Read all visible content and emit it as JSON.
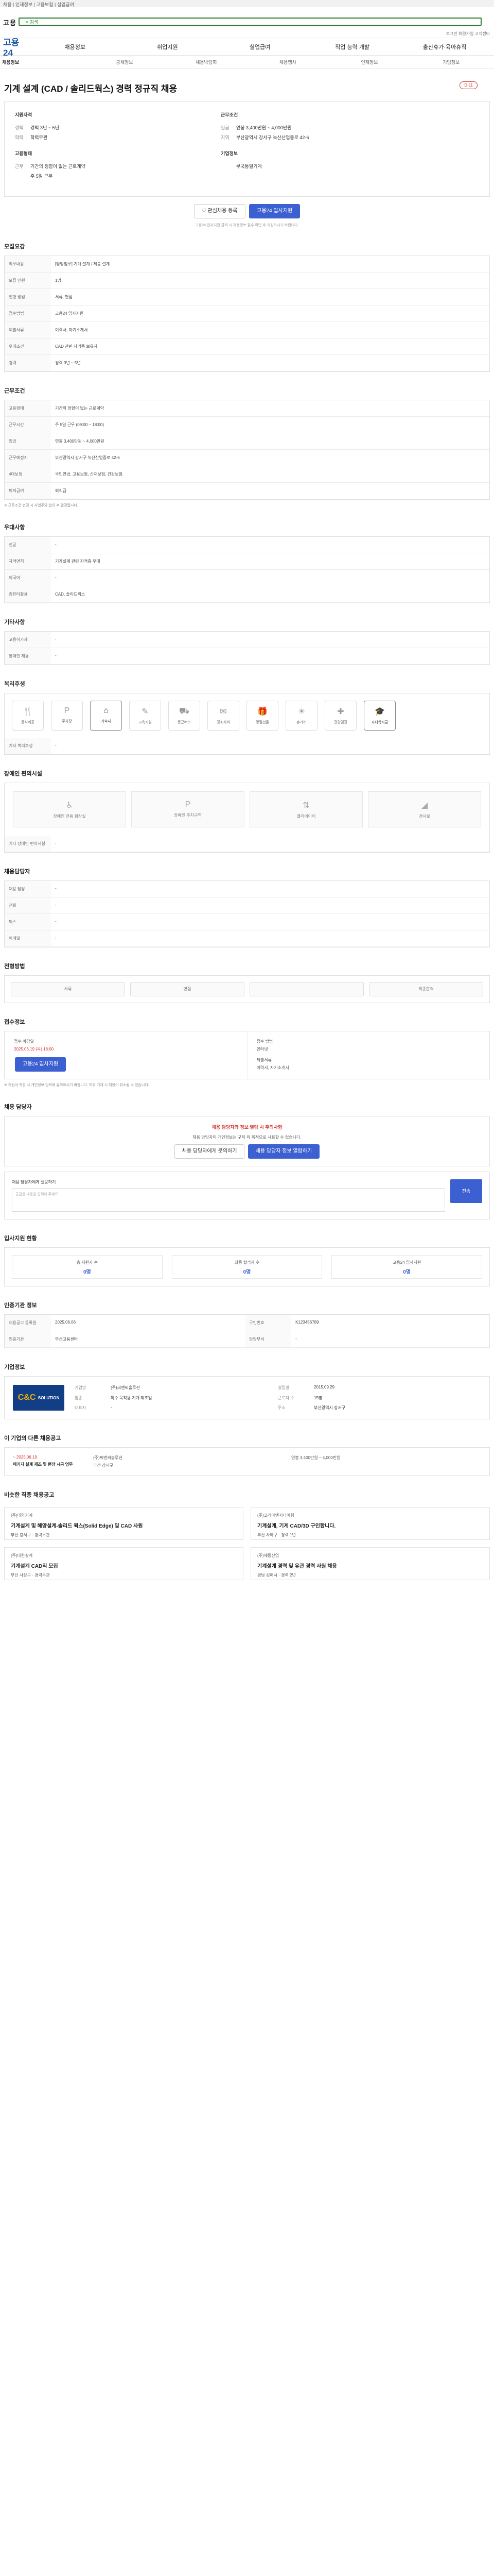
{
  "top_link": "채용 | 인재정보 | 고용보험 | 실업급여",
  "header": {
    "logo": "고용",
    "search_placeholder": "검색",
    "util": "로그인 회원가입 고객센터"
  },
  "gnb": {
    "brand": "고용24",
    "menu": [
      "채용정보",
      "취업지원",
      "실업급여",
      "직업 능력 개발",
      "출산휴가·육아휴직"
    ]
  },
  "subnav": [
    "채용정보",
    "공채정보",
    "채용박람회",
    "채용행사",
    "인재정보",
    "기업정보"
  ],
  "job": {
    "title": "기계 설계 (CAD / 솔리드웍스) 경력 정규직 채용",
    "badge": "D-11",
    "col1_head": "지원자격",
    "col1": [
      [
        "경력",
        "경력 3년 ~ 5년"
      ],
      [
        "학력",
        "학력무관"
      ]
    ],
    "col1b_head": "고용형태",
    "col1b": [
      [
        "근무",
        "기간의 정함이 없는 근로계약"
      ],
      [
        "",
        "주 5일 근무"
      ]
    ],
    "col2_head": "근무조건",
    "col2": [
      [
        "임금",
        "연봉 3,400만원 ~ 4,000만원"
      ],
      [
        "지역",
        "부산광역시 강서구 녹산산업중로 42-6"
      ]
    ],
    "col2b_head": "기업정보",
    "col2b": [
      [
        "",
        "부국통일기계"
      ]
    ],
    "btn_fav": "♡ 관심채용 등록",
    "btn_apply": "고용24 입사지원",
    "note": "고용24 입사지원 클릭 시 채용정보 필수 확인 후 지원하시기 바랍니다."
  },
  "section_jobinfo": "모집요강",
  "job_rows": [
    {
      "k": "직무내용",
      "v": "[담당업무] 기계 설계 / 제품 설계"
    },
    {
      "k": "모집 인원",
      "v": "1명"
    },
    {
      "k": "전형 방법",
      "v": "서류, 면접"
    },
    {
      "k": "접수방법",
      "v": "고용24 입사지원"
    },
    {
      "k": "제출서류",
      "v": "이력서, 자기소개서"
    },
    {
      "k": "우대조건",
      "v": "CAD 관련 자격증 보유자"
    },
    {
      "k": "경력",
      "v": "경력 3년 ~ 5년"
    }
  ],
  "section_work": "근무조건",
  "work_rows": [
    {
      "k": "고용형태",
      "v": "기간의 정함이 없는 근로계약"
    },
    {
      "k": "근무시간",
      "v": "주 5일 근무 (09:00 ~ 18:00)"
    },
    {
      "k": "임금",
      "v": "연봉 3,400만원 ~ 4,000만원"
    },
    {
      "k": "근무예정지",
      "v": "부산광역시 강서구 녹산산업중로 42-6"
    },
    {
      "k": "4대보험",
      "v": "국민연금, 고용보험, 산재보험, 건강보험"
    },
    {
      "k": "퇴직급여",
      "v": "퇴직금"
    }
  ],
  "work_note": "※ 근로조건 변경 시 사업주와 협의 후 결정됩니다.",
  "section_pref": "우대사항",
  "pref_rows": [
    {
      "k": "전공",
      "v": "-"
    },
    {
      "k": "자격면허",
      "v": "기계설계 관련 자격증 우대"
    },
    {
      "k": "외국어",
      "v": "-"
    },
    {
      "k": "컴퓨터활용",
      "v": "CAD, 솔리드웍스"
    }
  ],
  "section_etc": "기타사항",
  "etc_rows": [
    {
      "k": "고용허가제",
      "v": "-"
    },
    {
      "k": "장애인 채용",
      "v": "-"
    }
  ],
  "section_welfare": "복리후생",
  "welfare": [
    "중식제공",
    "주차장",
    "기숙사",
    "교육지원",
    "통근버스",
    "경조사비",
    "명절선물",
    "휴가비",
    "건강검진",
    "자녀학자금"
  ],
  "welfare_on": [
    2,
    9
  ],
  "welfare_extra": {
    "k": "기타 복리후생",
    "v": "-"
  },
  "section_disab": "장애인 편의시설",
  "disab": [
    "장애인 전용 화장실",
    "장애인 주차구역",
    "엘리베이터",
    "경사로"
  ],
  "disab_extra": {
    "k": "기타 장애인 편의시설",
    "v": "-"
  },
  "section_assign": "채용담당자",
  "assign_rows": [
    {
      "k": "채용 담당",
      "v": "-"
    },
    {
      "k": "전화",
      "v": "-"
    },
    {
      "k": "팩스",
      "v": "-"
    },
    {
      "k": "이메일",
      "v": "-"
    }
  ],
  "section_proc": "전형방법",
  "proc_steps": [
    "서류",
    "면접",
    "",
    "최종합격"
  ],
  "section_recv": "접수정보",
  "recv": {
    "k1": "접수 마감일",
    "v1": "2025.06.19 (목) 18:00",
    "k2": "접수 방법",
    "v2": "인터넷",
    "btn": "고용24 입사지원",
    "k3": "제출서류",
    "v3": "이력서, 자기소개서",
    "k4": "제출 서류",
    "v4": "-"
  },
  "recv_notes": "※ 지원서 작성 시 개인정보 입력에 유의하시기 바랍니다. 허위 기재 시 채용이 취소될 수 있습니다.",
  "section_help": "채용 담당자",
  "help": {
    "title": "채용 담당자와 정보 열람 시 주의사항",
    "text": "채용 담당자의 개인정보는 구직 외 목적으로 사용할 수 없습니다.",
    "btn1": "채용 담당자에게 문의하기",
    "btn2": "채용 담당자 정보 열람하기"
  },
  "ask": {
    "label": "채용 담당자에게 질문하기",
    "placeholder": "궁금한 내용을 입력해 주세요.",
    "btn": "전송"
  },
  "section_stats": "입사지원 현황",
  "stats": [
    {
      "k": "총 지원자 수",
      "v": "0명"
    },
    {
      "k": "최종 합격자 수",
      "v": "0명"
    },
    {
      "k": "고용24 입사지원",
      "v": "0명"
    }
  ],
  "section_register": "인증기관 정보",
  "reg_rows": [
    {
      "k": "채용공고 등록일",
      "v": "2025.06.06",
      "k2": "구인번호",
      "v2": "K123456789"
    },
    {
      "k": "인증기관",
      "v": "부산고용센터",
      "k2": "담당부서",
      "v2": "-"
    }
  ],
  "section_company": "기업정보",
  "company": {
    "logo_a": "C&C",
    "logo_b": "SOLUTION",
    "rows": [
      [
        "기업명",
        "(주)씨앤씨솔루션"
      ],
      [
        "설립일",
        "2015.09.29"
      ],
      [
        "업종",
        "특수 목적용 기계 제조업"
      ],
      [
        "근로자 수",
        "15명"
      ],
      [
        "대표자",
        "-"
      ],
      [
        "주소",
        "부산광역시 강서구"
      ]
    ]
  },
  "section_rec": "이 기업의 다른 채용공고",
  "rec": {
    "date": "~ 2025.06.19",
    "title": "패키지 설계 제조 및 현장 시공 업무",
    "co": "(주)씨앤씨솔루션",
    "loc": "부산 강서구",
    "pay": "연봉 3,400만원 ~ 4,000만원"
  },
  "section_similar": "비슷한 직종 채용공고",
  "cards": [
    {
      "co": "(주)대양기계",
      "title": "기계설계 및 해양설계-솔리드 웍스(Solid Edge) 및 CAD 사원",
      "meta": "부산 강서구 · 경력무관"
    },
    {
      "co": "(주)코리아엔지니어링",
      "title": "기계설계, 기계 CAD/3D 구인합니다.",
      "meta": "부산 사하구 · 경력 1년"
    },
    {
      "co": "(주)대한설계",
      "title": "기계설계 CAD직 모집",
      "meta": "부산 사상구 · 경력무관"
    },
    {
      "co": "(주)해동산업",
      "title": "기계설계 경력 및 유관 경력 사원 채용",
      "meta": "경남 김해시 · 경력 2년"
    }
  ]
}
